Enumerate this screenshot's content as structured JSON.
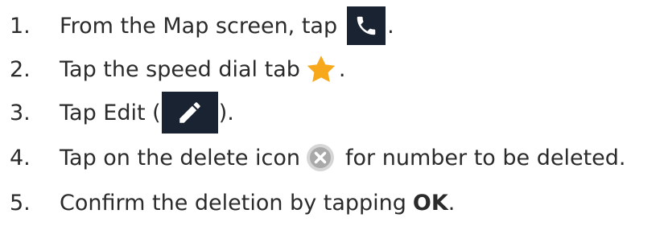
{
  "steps": [
    {
      "number": "1.",
      "text_before": "From the Map screen, tap",
      "icon": "phone-icon",
      "text_after": "."
    },
    {
      "number": "2.",
      "text_before": "Tap the speed dial tab",
      "icon": "star-icon",
      "text_after": "."
    },
    {
      "number": "3.",
      "text_before": "Tap Edit (",
      "icon": "pencil-icon",
      "text_after": ")."
    },
    {
      "number": "4.",
      "text_before": "Tap on the delete icon",
      "icon": "delete-icon",
      "text_after": "for number to be deleted."
    },
    {
      "number": "5.",
      "text_before": "Confirm the deletion by tapping",
      "bold": "OK",
      "text_after": "."
    }
  ],
  "colors": {
    "text": "#2b2b2b",
    "icon_background": "#1a2332",
    "star": "#f7a81b",
    "delete_circle": "#a9a9a9"
  }
}
